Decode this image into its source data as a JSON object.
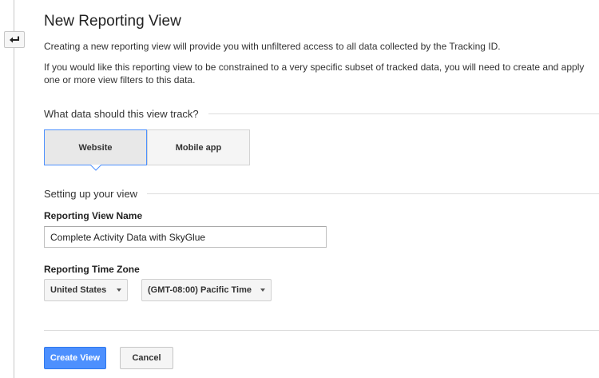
{
  "header": {
    "back_icon": "back-arrow-icon",
    "title": "New Reporting View"
  },
  "intro": {
    "paragraph_1": "Creating a new reporting view will provide you with unfiltered access to all data collected by the Tracking ID.",
    "paragraph_2": "If you would like this reporting view to be constrained to a very specific subset of tracked data, you will need to create and apply one or more view filters to this data."
  },
  "track_section": {
    "heading": "What data should this view track?",
    "options": [
      {
        "label": "Website",
        "selected": true
      },
      {
        "label": "Mobile app",
        "selected": false
      }
    ]
  },
  "setup_section": {
    "heading": "Setting up your view",
    "name_label": "Reporting View Name",
    "name_value": "Complete Activity Data with SkyGlue",
    "timezone_label": "Reporting Time Zone",
    "country_value": "United States",
    "timezone_value": "(GMT-08:00) Pacific Time"
  },
  "actions": {
    "create_label": "Create View",
    "cancel_label": "Cancel"
  },
  "colors": {
    "accent": "#4d90fe",
    "accent_border": "#3079ed"
  }
}
